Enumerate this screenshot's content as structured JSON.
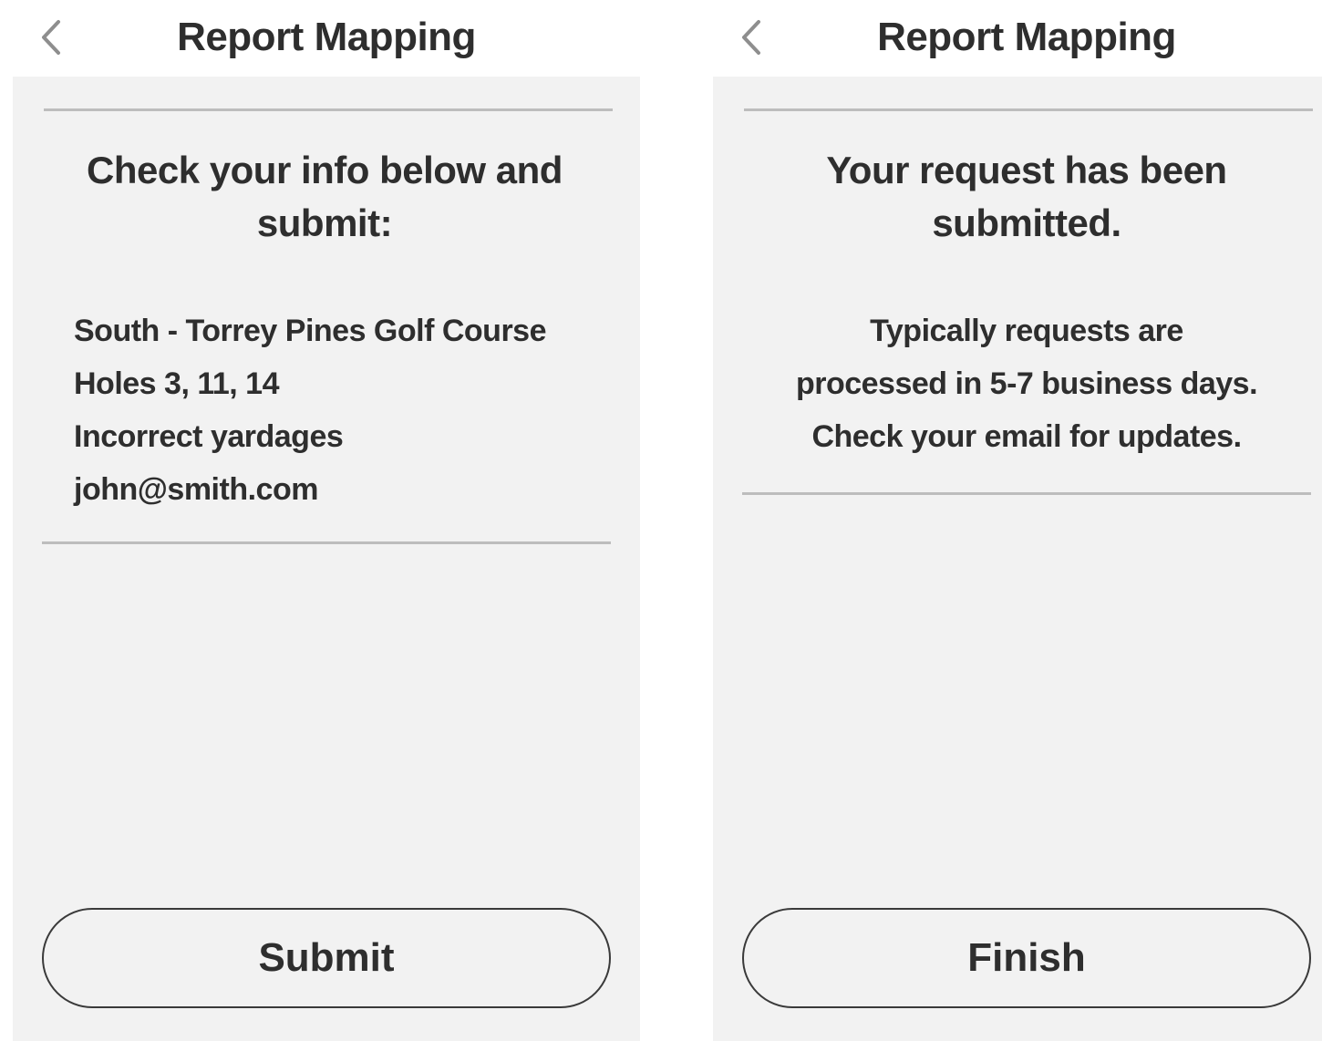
{
  "confirm_screen": {
    "header": {
      "back_icon": "chevron-left-icon",
      "title": "Report Mapping"
    },
    "heading_lines": [
      "Check your info below and",
      "submit:"
    ],
    "details": [
      "South - Torrey Pines Golf Course",
      "Holes 3, 11, 14",
      "Incorrect yardages",
      "john@smith.com"
    ],
    "submit_label": "Submit"
  },
  "success_screen": {
    "header": {
      "back_icon": "chevron-left-icon",
      "title": "Report Mapping"
    },
    "heading_lines": [
      "Your request has been",
      "submitted."
    ],
    "message_lines": [
      "Typically requests are",
      "processed in 5-7 business days.",
      "Check your email for updates."
    ],
    "finish_label": "Finish"
  },
  "colors": {
    "panel_background": "#f2f2f2",
    "text": "#2e2e2e",
    "divider": "#bdbdbd",
    "back_icon": "#8e8e8e"
  }
}
